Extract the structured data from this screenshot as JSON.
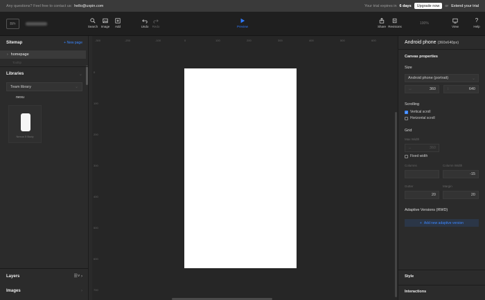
{
  "topbar": {
    "question_text": "Any questions? Feel free to contact us:",
    "email": "hello@uxpin.com",
    "trial_prefix": "Your trial expires in",
    "trial_days": "6 days",
    "upgrade_label": "Upgrade now",
    "or_text": "or",
    "extend_label": "Extend your trial"
  },
  "toolbar": {
    "avatar": "BPr",
    "project_name": "Workbench",
    "search": "Search",
    "image": "Image",
    "add": "Add",
    "undo": "Undo",
    "redo": "Redo",
    "preview": "Preview",
    "share": "Share",
    "revisions": "Revisions",
    "zoom": "100%",
    "view": "View",
    "help": "Help"
  },
  "sitemap": {
    "title": "Sitemap",
    "new_page": "+ New page",
    "pages": [
      {
        "label": "homepage"
      }
    ],
    "sub_label": "Tooltip"
  },
  "libraries": {
    "title": "Libraries",
    "selected": "Team library",
    "items": [
      {
        "label": "nexu"
      }
    ],
    "card_label": "Nexus 5 Body"
  },
  "left_bottom": {
    "layers": "Layers",
    "images": "Images"
  },
  "rulers": {
    "top": [
      "-300",
      "-200",
      "-100",
      "0",
      "100",
      "200",
      "300",
      "400",
      "500",
      "600"
    ],
    "left": [
      "0",
      "100",
      "200",
      "300",
      "400",
      "500",
      "600",
      "700"
    ]
  },
  "properties": {
    "device": "Android phone",
    "device_size": "(360x640px)",
    "canvas_title": "Canvas properties",
    "size_label": "Size",
    "size_select": "Android phone (portrait)",
    "width": "360",
    "height": "640",
    "scrolling_label": "Scrolling",
    "vertical_scroll": "Vertical scroll",
    "horizontal_scroll": "Horizontal scroll",
    "grid_label": "Grid",
    "max_width_label": "Max Width",
    "max_width": "360",
    "fixed_width": "Fixed width",
    "columns_label": "Columns",
    "column_width_label": "Column Width",
    "column_width": "-15",
    "gutter_label": "Gutter",
    "gutter": "20",
    "margin_label": "Margin",
    "margin": "20",
    "adaptive_title": "Adaptive Versions (RWD)",
    "add_adaptive": "Add new adaptive version",
    "style": "Style",
    "interactions": "Interactions"
  },
  "colors": {
    "accent": "#3b86ff",
    "panel": "#2b2b2b",
    "canvas": "#262626",
    "artboard": "#ffffff"
  }
}
